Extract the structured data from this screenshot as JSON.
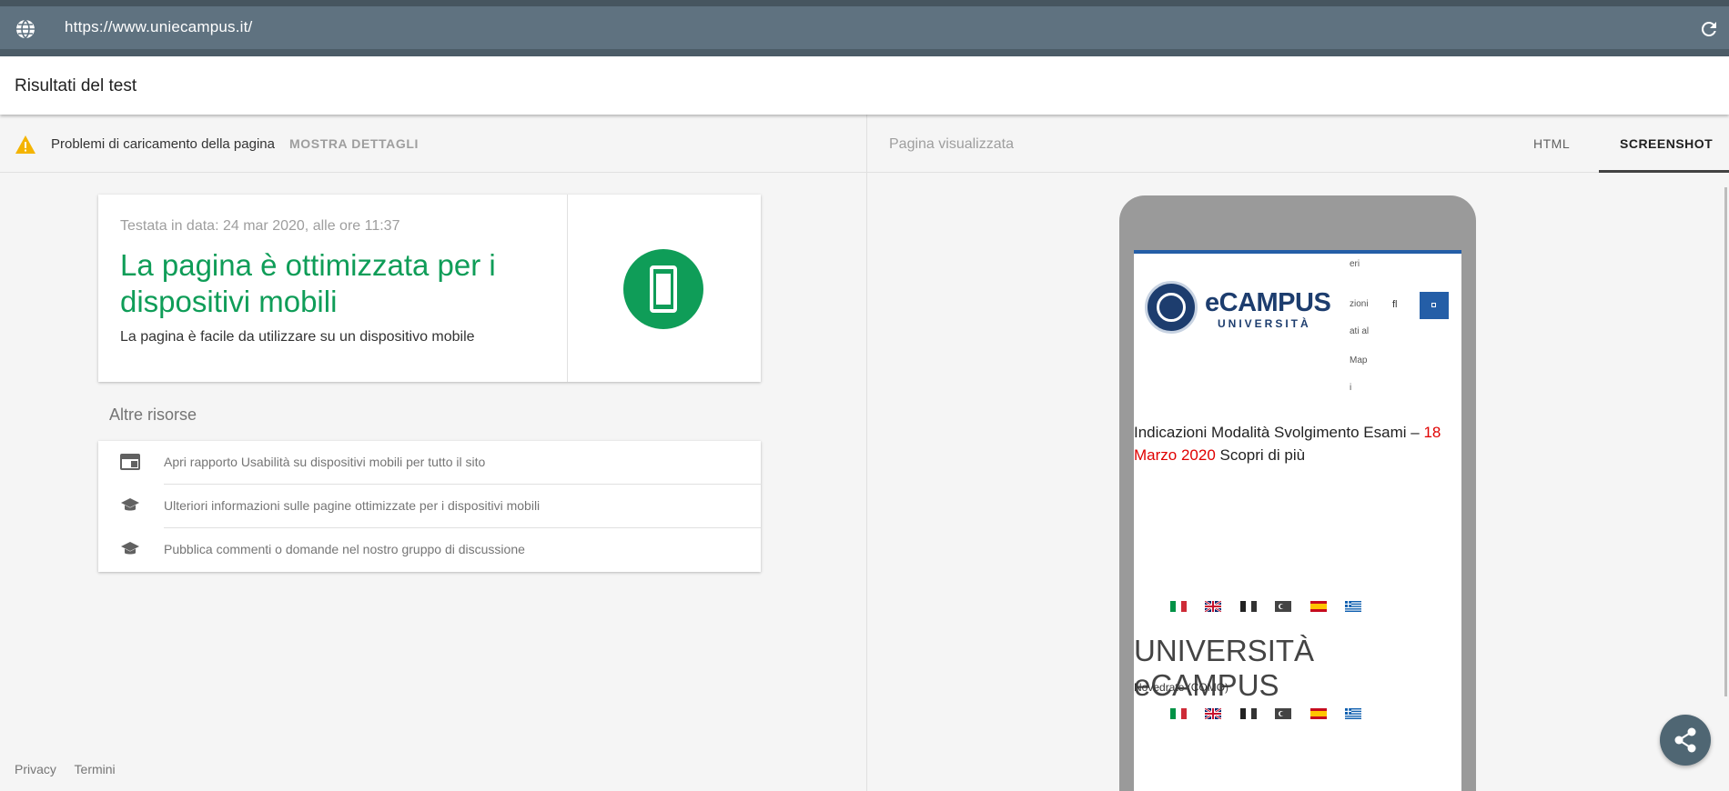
{
  "urlbar": {
    "url": "https://www.uniecampus.it/"
  },
  "header": {
    "title": "Risultati del test"
  },
  "status": {
    "message": "Problemi di caricamento della pagina",
    "details_label": "MOSTRA DETTAGLI"
  },
  "result_card": {
    "date": "Testata in data: 24 mar 2020, alle ore 11:37",
    "headline": "La pagina è ottimizzata per i dispositivi mobili",
    "subtext": "La pagina è facile da utilizzare su un dispositivo mobile"
  },
  "resources": {
    "title": "Altre risorse",
    "items": [
      {
        "icon": "web-icon",
        "label": "Apri rapporto Usabilità su dispositivi mobili per tutto il sito"
      },
      {
        "icon": "school-icon",
        "label": "Ulteriori informazioni sulle pagine ottimizzate per i dispositivi mobili"
      },
      {
        "icon": "school-icon",
        "label": "Pubblica commenti o domande nel nostro gruppo di discussione"
      }
    ]
  },
  "footer": {
    "privacy": "Privacy",
    "terms": "Termini"
  },
  "rendered": {
    "label": "Pagina visualizzata",
    "tabs": {
      "html": "HTML",
      "screenshot": "SCREENSHOT"
    },
    "active_tab": "SCREENSHOT"
  },
  "preview": {
    "logo_word": "eCAMPUS",
    "logo_sub": "UNIVERSITÀ",
    "menu_fragments": [
      "eri",
      "zioni",
      "ati al",
      "Map",
      "i"
    ],
    "menu_short": "fl",
    "news_text": "Indicazioni Modalità Svolgimento Esami – ",
    "news_date": "18 Marzo 2020",
    "news_more": " Scopri di più",
    "big_title": "UNIVERSITÀ eCAMPUS",
    "city": "Novedrate (COMO)",
    "flags": [
      "italy",
      "uk",
      "france",
      "turkey",
      "spain",
      "greece"
    ]
  },
  "colors": {
    "urlbar": "#5f7280",
    "success": "#0f9d58",
    "warning": "#f4b400",
    "brand_blue": "#1d3d6e",
    "accent_red": "#e00000",
    "fab": "#4f6673"
  }
}
